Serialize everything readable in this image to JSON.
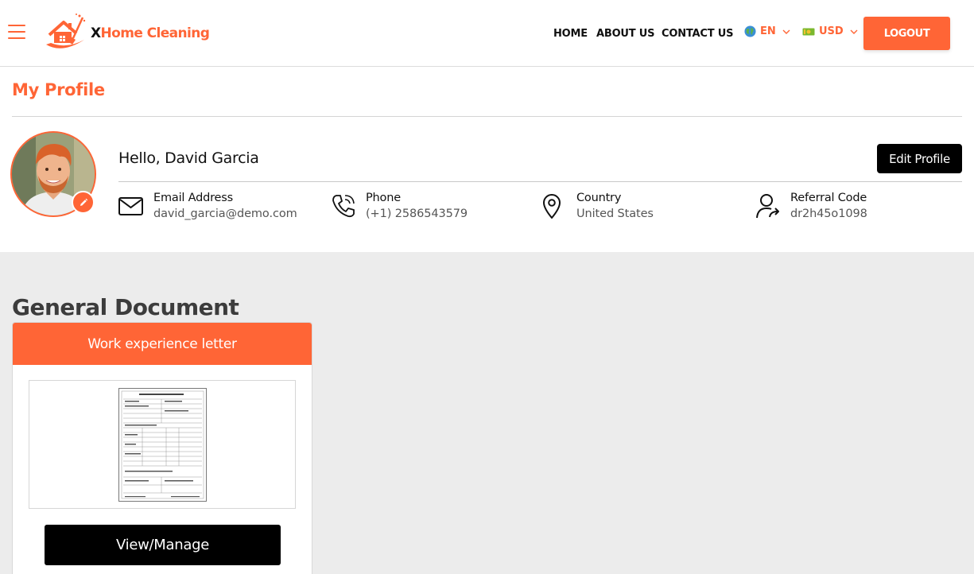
{
  "brand": {
    "name_prefix": "X",
    "name_rest": "Home Cleaning",
    "accent_color": "#ff6536"
  },
  "nav": {
    "home": "HOME",
    "about": "ABOUT US",
    "contact": "CONTACT US",
    "language": {
      "value": "EN",
      "icon": "globe-icon"
    },
    "currency": {
      "value": "USD",
      "icon": "banknote-icon"
    },
    "logout": "LOGOUT"
  },
  "profile": {
    "title": "My Profile",
    "greeting": "Hello, David Garcia",
    "edit_label": "Edit Profile",
    "fields": [
      {
        "label": "Email Address",
        "value": "david_garcia@demo.com",
        "icon": "mail-icon"
      },
      {
        "label": "Phone",
        "value": "(+1) 2586543579",
        "icon": "phone-icon"
      },
      {
        "label": "Country",
        "value": "United States",
        "icon": "location-pin-icon"
      },
      {
        "label": "Referral Code",
        "value": "dr2h45o1098",
        "icon": "user-share-icon"
      }
    ]
  },
  "documents": {
    "section_title": "General Document",
    "cards": [
      {
        "title": "Work experience letter",
        "action": "View/Manage"
      }
    ]
  }
}
